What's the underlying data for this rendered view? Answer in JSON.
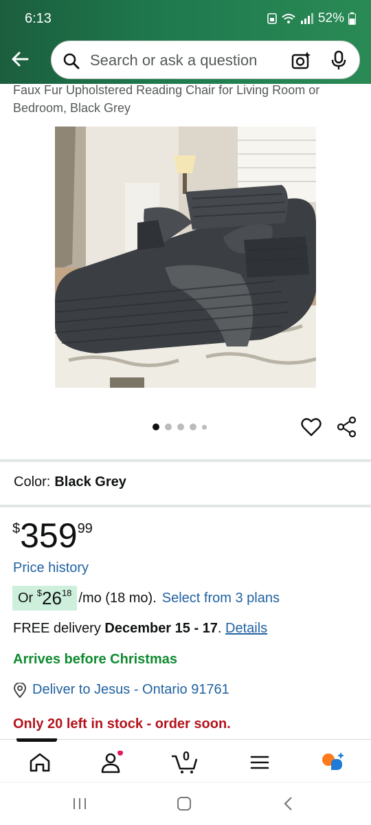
{
  "status_bar": {
    "time": "6:13",
    "battery": "52%"
  },
  "search": {
    "placeholder": "Search or ask a question"
  },
  "product": {
    "title": "Faux Fur Upholstered Reading Chair for Living Room or Bedroom, Black Grey",
    "carousel": {
      "total": 5,
      "active": 0
    },
    "color_label": "Color:",
    "color_value": "Black Grey",
    "price": {
      "currency": "$",
      "whole": "359",
      "fraction": "99"
    },
    "price_history": "Price history",
    "monthly": {
      "or": "Or",
      "currency": "$",
      "whole": "26",
      "fraction": "18",
      "suffix": "/mo (18 mo).",
      "plans_link": "Select from 3 plans"
    },
    "delivery": {
      "prefix": "FREE delivery",
      "dates": "December 15 - 17",
      "period": ".",
      "details_link": "Details"
    },
    "arrives": "Arrives before Christmas",
    "deliver_to": "Deliver to Jesus - Ontario 91761",
    "stock": "Only 20 left in stock - order soon."
  },
  "bottom_nav": {
    "cart_count": "0",
    "items": [
      "home",
      "account",
      "cart",
      "menu",
      "rufus"
    ]
  },
  "colors": {
    "header_green": "#1f7a4e",
    "link": "#2162a1",
    "arrives_green": "#0f8a2f",
    "stock_red": "#b3121b",
    "chip_green": "#cdefdc"
  }
}
